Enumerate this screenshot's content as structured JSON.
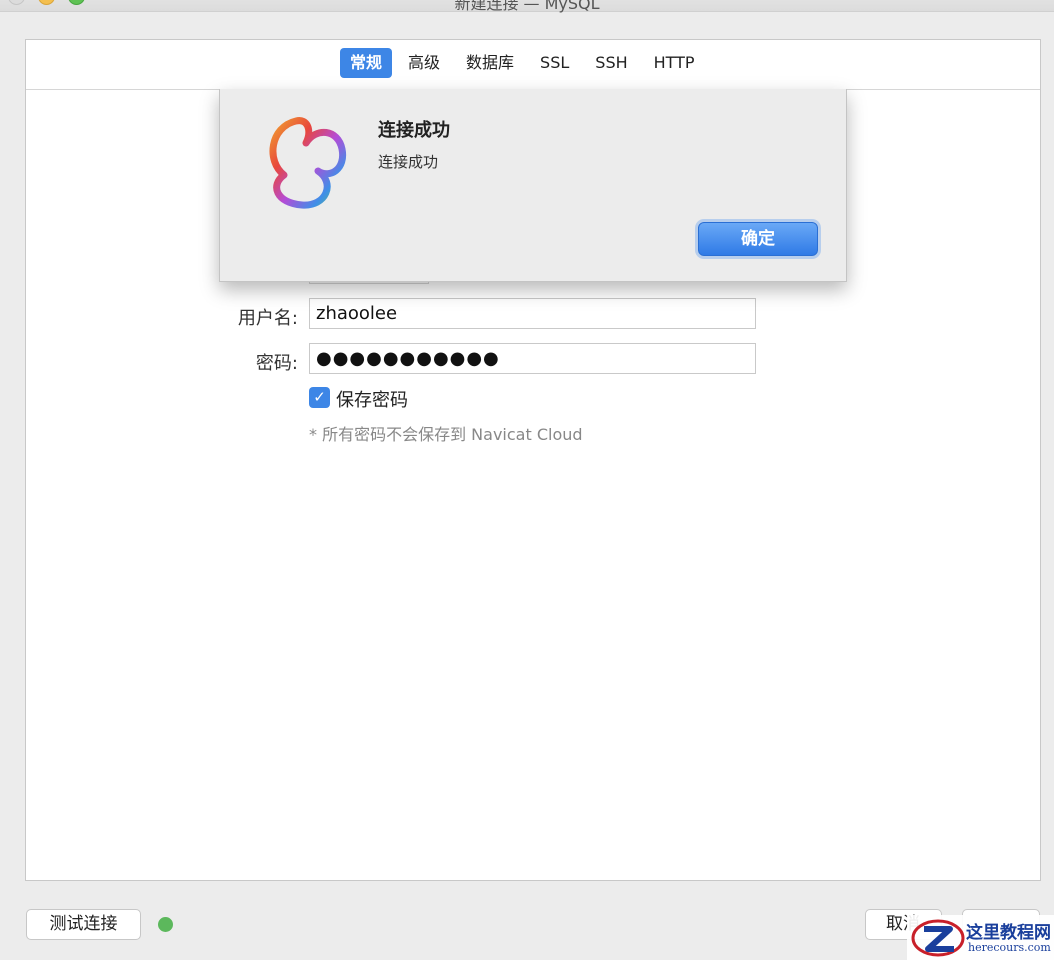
{
  "window": {
    "title": "新建连接 — MySQL"
  },
  "tabs": [
    {
      "label": "常规",
      "active": true
    },
    {
      "label": "高级",
      "active": false
    },
    {
      "label": "数据库",
      "active": false
    },
    {
      "label": "SSL",
      "active": false
    },
    {
      "label": "SSH",
      "active": false
    },
    {
      "label": "HTTP",
      "active": false
    }
  ],
  "form": {
    "username_label": "用户名:",
    "username_value": "zhaoolee",
    "password_label": "密码:",
    "password_value": "●●●●●●●●●●●",
    "save_password_label": "保存密码",
    "save_password_checked": true,
    "note": "* 所有密码不会保存到 Navicat Cloud"
  },
  "dialog": {
    "title": "连接成功",
    "message": "连接成功",
    "ok_label": "确定",
    "logo_icon": "navicat-logo-icon"
  },
  "bottom": {
    "test_connection_label": "测试连接",
    "status_color": "#5cb85c",
    "cancel_label": "取消"
  },
  "watermark": {
    "title": "这里教程网",
    "subtitle": "herecours.com"
  },
  "colors": {
    "accent": "#3d86e6",
    "status_ok": "#5cb85c"
  }
}
